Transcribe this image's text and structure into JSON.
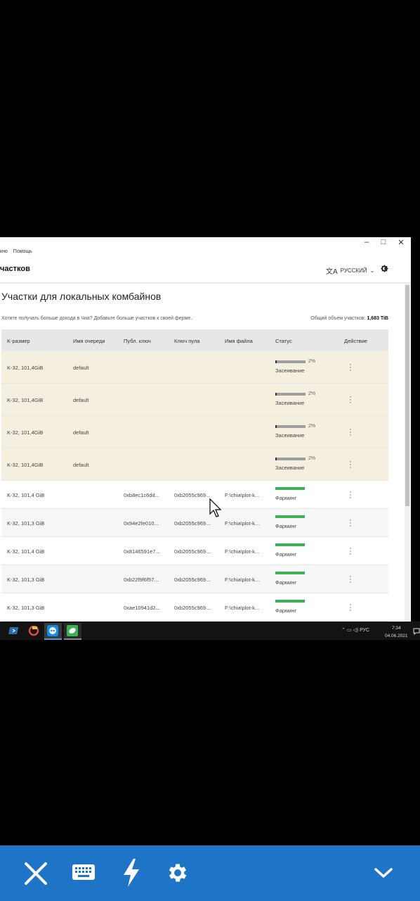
{
  "menu": [
    "кно",
    "Помощь"
  ],
  "window_controls": {
    "minimize": "–",
    "maximize": "□",
    "close": "✕"
  },
  "app": {
    "title": "частков",
    "language": "РУССКИЙ"
  },
  "page": {
    "title": "Участки для локальных комбайнов",
    "info": "Хотите получать больше дохода в Чиа? Добавьте больше участков к своей ферме.",
    "total_label": "Общий объем участков:",
    "total_value": "1,683 TiB"
  },
  "table": {
    "headers": [
      "K-размер",
      "Имя очереди",
      "Публ. ключ",
      "Ключ пула",
      "Имя файла",
      "Статус",
      "Действие"
    ],
    "plotting_rows": [
      {
        "size": "K-32, 101,4GiB",
        "queue": "default",
        "progress": 2,
        "pct": "2%",
        "status": "Засеивание"
      },
      {
        "size": "K-32, 101,4GiB",
        "queue": "default",
        "progress": 2,
        "pct": "2%",
        "status": "Засеивание"
      },
      {
        "size": "K-32, 101,4GiB",
        "queue": "default",
        "progress": 2,
        "pct": "2%",
        "status": "Засеивание"
      },
      {
        "size": "K-32, 101,4GiB",
        "queue": "default",
        "progress": 2,
        "pct": "2%",
        "status": "Засеивание"
      }
    ],
    "farm_rows": [
      {
        "size": "K-32, 101,4 GiB",
        "pubkey": "0xb8ec1c6dd...",
        "poolkey": "0xb2055c969...",
        "file": "F:\\chia\\plot-k...",
        "status": "Фарминг"
      },
      {
        "size": "K-32, 101,3 GiB",
        "pubkey": "0x94e2fe010...",
        "poolkey": "0xb2055c969...",
        "file": "F:\\chia\\plot-k...",
        "status": "Фарминг"
      },
      {
        "size": "K-32, 101,4 GiB",
        "pubkey": "0x8146591e7...",
        "poolkey": "0xb2055c969...",
        "file": "F:\\chia\\plot-k...",
        "status": "Фарминг"
      },
      {
        "size": "K-32, 101,3 GiB",
        "pubkey": "0xb22f9f6f57...",
        "poolkey": "0xb2055c969...",
        "file": "F:\\chia\\plot-k...",
        "status": "Фарминг"
      },
      {
        "size": "K-32, 101,3 GiB",
        "pubkey": "0xae10941d2...",
        "poolkey": "0xb2055c969...",
        "file": "F:\\chia\\plot-k...",
        "status": "Фарминг"
      }
    ]
  },
  "taskbar": {
    "lang": "РУС",
    "time": "7:34",
    "date": "04.06.2021"
  },
  "colors": {
    "plotting_bg": "#f5efe0",
    "progress_grey": "#9e9e9e",
    "farming_green": "#3cb054",
    "remote_bar": "#1e75c8"
  },
  "bottom_bar": {
    "icons": [
      "close-icon",
      "keyboard-icon",
      "lightning-icon",
      "gear-icon",
      "chevron-down-icon"
    ]
  }
}
